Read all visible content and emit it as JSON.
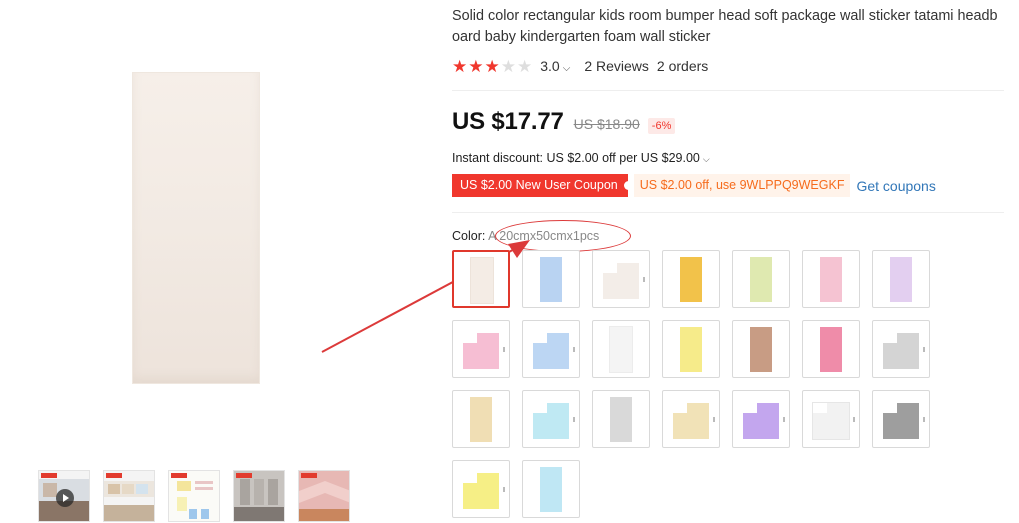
{
  "product": {
    "title": "Solid color rectangular kids room bumper head soft package wall sticker tatami headboard baby kindergarten foam wall sticker",
    "rating": {
      "stars_filled": 3,
      "stars_total": 5,
      "score": "3.0",
      "reviews": "2 Reviews",
      "orders": "2 orders"
    },
    "price": "US $17.77",
    "old_price": "US $18.90",
    "discount": "-6%",
    "instant_discount": "Instant discount: US $2.00 off per US $29.00",
    "coupons": {
      "new_user": "US $2.00 New User Coupon",
      "code": "US $2.00 off, use 9WLPPQ9WEGKF",
      "get": "Get coupons"
    },
    "color": {
      "label": "Color:",
      "value": "A 20cmx50cmx1pcs"
    }
  },
  "swatch_colors": [
    "#f4ece5",
    "#b9d3f2",
    "#f3ede8",
    "#f2c24a",
    "#dfe9b0",
    "#f5c3d2",
    "#e3cff0",
    "#f6bed3",
    "#bcd6f3",
    "#f4f4f4",
    "#f6eb8a",
    "#c89c84",
    "#ef8ca9",
    "#d4d4d4",
    "#f0deb4",
    "#bfe9f3",
    "#d9d9d9",
    "#f1e2b7",
    "#c3a6ee",
    "#f2f2f2",
    "#9e9e9e",
    "#f6ef86",
    "#bfe7f4"
  ],
  "accent": "#f0372d",
  "link_color": "#3277b8",
  "coupon_orange": "#f66b1c"
}
